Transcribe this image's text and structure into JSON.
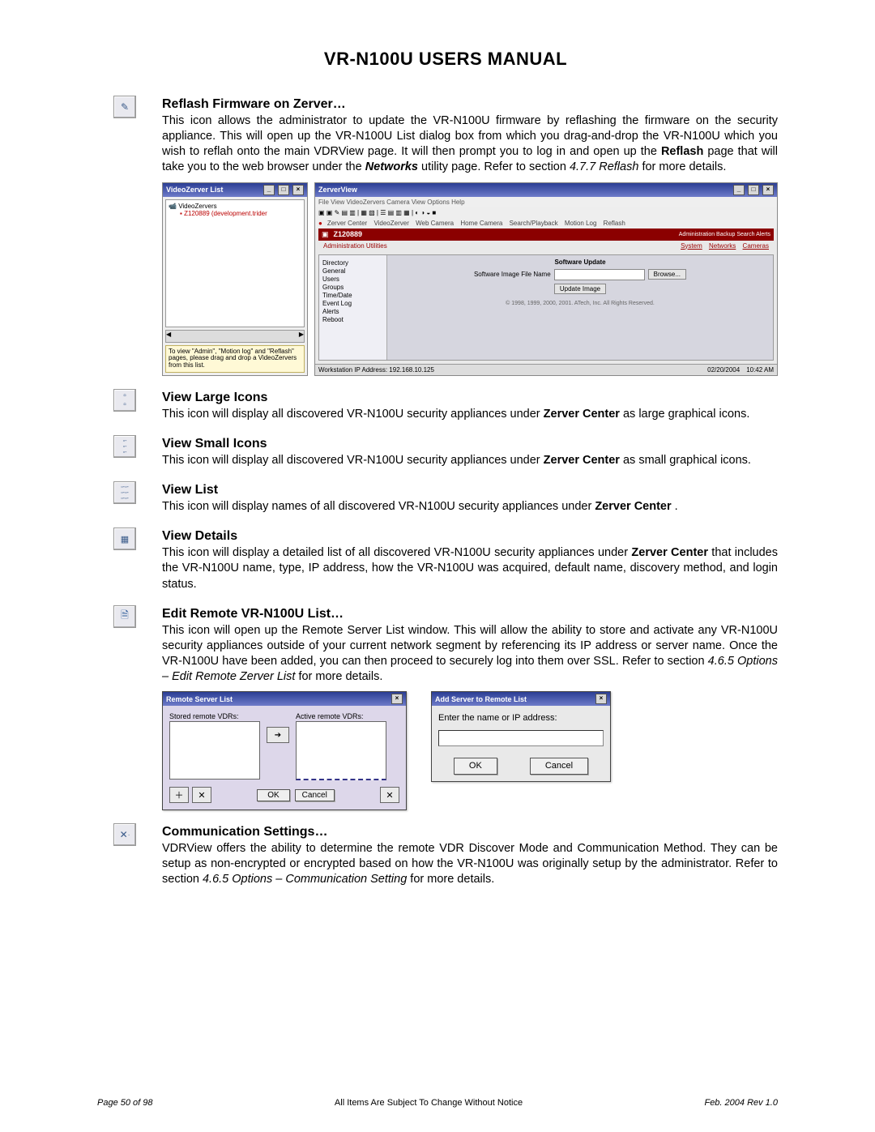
{
  "header": {
    "title": "VR-N100U USERS MANUAL"
  },
  "sections": {
    "reflash": {
      "heading": "Reflash Firmware on Zerver…",
      "p1a": "This icon allows the administrator to update the VR-N100U firmware by reflashing the firmware on the security appliance. This will open up the VR-N100U List dialog box from which you drag-and-drop the VR-N100U which you wish to reflah onto the main VDRView page. It will then prompt you to log in and open up the ",
      "p1b": "Reflash",
      "p1c": " page that will take you to the web browser under the ",
      "p1d": "Networks",
      "p1e": " utility page. Refer to section ",
      "p1f": "4.7.7 Reflash",
      "p1g": " for more details."
    },
    "large": {
      "heading": "View Large Icons",
      "p1a": "This icon will display all discovered VR-N100U security appliances under ",
      "p1b": "Zerver Center",
      "p1c": " as large graphical icons."
    },
    "small": {
      "heading": "View Small Icons",
      "p1a": "This icon will display all discovered VR-N100U security appliances under ",
      "p1b": "Zerver Center",
      "p1c": " as small graphical icons."
    },
    "list": {
      "heading": "View List",
      "p1a": "This icon will display names of all discovered VR-N100U security appliances under ",
      "p1b": "Zerver Center",
      "p1c": "."
    },
    "details": {
      "heading": "View Details",
      "p1a": "This icon will display a detailed list of all discovered VR-N100U security appliances under ",
      "p1b": "Zerver Center",
      "p1c": " that includes the VR-N100U name, type, IP address, how the VR-N100U was acquired, default name, discovery method, and login status."
    },
    "edit": {
      "heading": "Edit Remote VR-N100U List…",
      "p1a": "This icon will open up the Remote Server List window. This will allow the ability to store and activate any VR-N100U security appliances outside of your current network segment by referencing its IP address or server name.  Once the VR-N100U have been added, you can then proceed to securely log into them over SSL. Refer to section ",
      "p1b": "4.6.5 Options – Edit Remote Zerver List",
      "p1c": " for more details."
    },
    "comm": {
      "heading": "Communication Settings…",
      "p1a": "VDRView offers the ability to determine the remote VDR Discover Mode and Communication Method. They can be setup as non-encrypted or encrypted based on how the VR-N100U was originally setup by the administrator. Refer to section ",
      "p1b": "4.6.5 Options – Communication Setting",
      "p1c": " for more details."
    }
  },
  "fig1": {
    "vzlist_title": "VideoZerver List",
    "root": "VideoZervers",
    "item": "Z120889 (development.trider",
    "hint": "To view \"Admin\", \"Motion log\" and \"Reflash\" pages, please drag and drop a VideoZervers from this list.",
    "main_title": "ZerverView",
    "menubar": "File  View  VideoZervers  Camera View  Options  Help",
    "tabs": [
      "Zerver Center",
      "VideoZerver",
      "Web Camera",
      "Home Camera",
      "Search/Playback",
      "Motion Log",
      "Reflash"
    ],
    "zname": "Z120889",
    "zright": "Administration  Backup  Search  Alerts",
    "utils_left": "Administration Utilities",
    "utils_right": [
      "System",
      "Networks",
      "Cameras"
    ],
    "sidebar_items": [
      "Directory",
      "General",
      "Users",
      "Groups",
      "Time/Date",
      "Event Log",
      "Alerts",
      "Reboot"
    ],
    "sw_title": "Software Update",
    "sw_label": "Software Image File Name",
    "sw_browse": "Browse...",
    "sw_update": "Update Image",
    "copyright": "© 1998, 1999, 2000, 2001. ATech, Inc. All Rights Reserved.",
    "status_left": "Workstation IP Address: 192.168.10.125",
    "status_date": "02/20/2004",
    "status_time": "10:42 AM"
  },
  "fig2": {
    "dlg1_title": "Remote Server List",
    "dlg1_stored": "Stored remote VDRs:",
    "dlg1_active": "Active remote VDRs:",
    "ok": "OK",
    "cancel": "Cancel",
    "dlg2_title": "Add Server to Remote List",
    "dlg2_prompt": "Enter the name or IP address:"
  },
  "footer": {
    "left": "Page 50 of 98",
    "center": "All Items Are Subject To Change Without Notice",
    "right": "Feb. 2004 Rev 1.0"
  }
}
